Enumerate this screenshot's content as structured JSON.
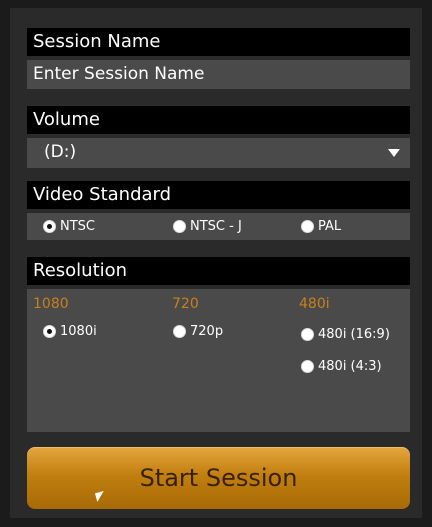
{
  "session": {
    "header": "Session Name",
    "placeholder": "Enter Session Name"
  },
  "volume": {
    "header": "Volume",
    "selected": "(D:)"
  },
  "video_standard": {
    "header": "Video Standard",
    "options": [
      "NTSC",
      "NTSC - J",
      "PAL"
    ],
    "selected": "NTSC"
  },
  "resolution": {
    "header": "Resolution",
    "columns": [
      {
        "title": "1080",
        "options": [
          "1080i"
        ]
      },
      {
        "title": "720",
        "options": [
          "720p"
        ]
      },
      {
        "title": "480i",
        "options": [
          "480i (16:9)",
          "480i (4:3)"
        ]
      }
    ],
    "selected": "1080i"
  },
  "actions": {
    "start_label": "Start Session"
  },
  "colors": {
    "background": "#1b1b1b",
    "panel": "#2a2a2a",
    "header": "#000000",
    "field": "#4a4a4a",
    "accent": "#c8801c",
    "button_top": "#e6a640",
    "button_bottom": "#a86a06"
  }
}
